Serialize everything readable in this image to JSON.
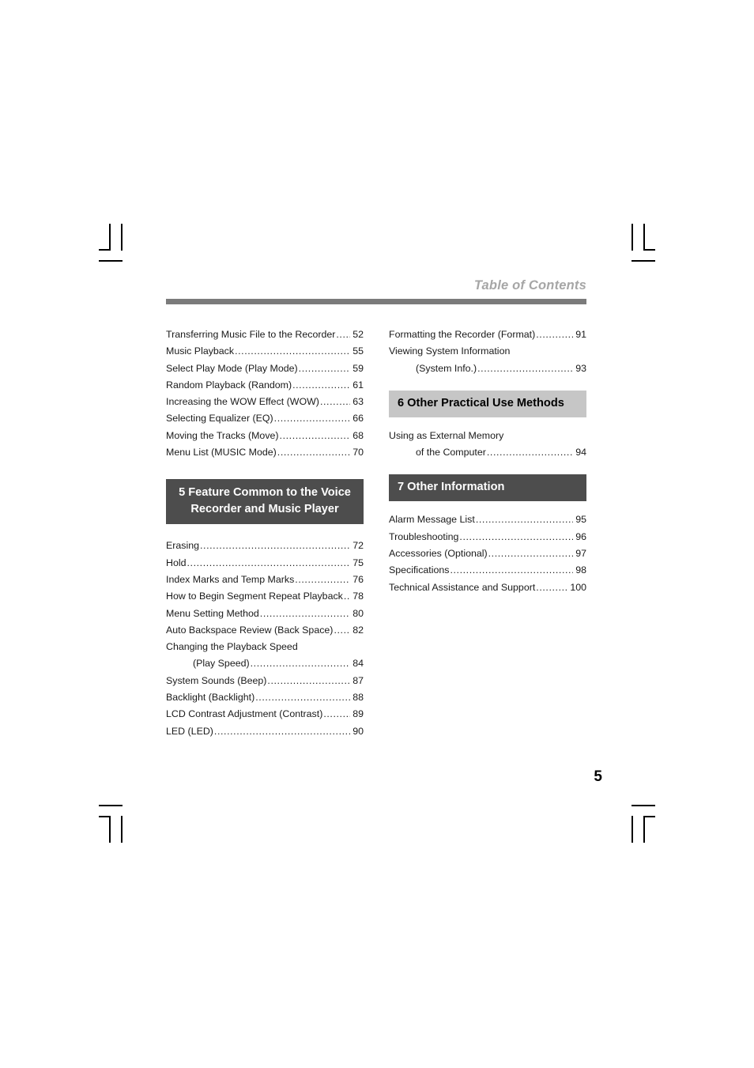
{
  "page": {
    "running_head": "Table of Contents",
    "folio": "5"
  },
  "left_column": {
    "entries_top": [
      {
        "title": "Transferring Music File to the Recorder",
        "page": "52"
      },
      {
        "title": "Music Playback",
        "page": "55"
      },
      {
        "title": "Select Play Mode (Play Mode)",
        "page": "59"
      },
      {
        "title": "Random Playback (Random)",
        "page": "61"
      },
      {
        "title": "Increasing the WOW Effect (WOW)",
        "page": "63"
      },
      {
        "title": "Selecting Equalizer (EQ)",
        "page": "66"
      },
      {
        "title": "Moving the Tracks (Move)",
        "page": "68"
      },
      {
        "title": "Menu List (MUSIC Mode)",
        "page": "70"
      }
    ],
    "section_5": {
      "line1": "5 Feature Common to the Voice",
      "line2": "Recorder and Music Player"
    },
    "entries_bottom": [
      {
        "title": "Erasing",
        "page": "72"
      },
      {
        "title": "Hold",
        "page": "75"
      },
      {
        "title": "Index Marks and Temp Marks",
        "page": "76"
      },
      {
        "title": "How to Begin Segment Repeat Playback",
        "page": "78"
      },
      {
        "title": "Menu Setting Method",
        "page": "80"
      },
      {
        "title": "Auto Backspace Review (Back Space)",
        "page": "82"
      },
      {
        "title": "Changing the Playback Speed",
        "page": "",
        "wrapped": true
      },
      {
        "title": "(Play Speed)",
        "page": "84",
        "indent": true
      },
      {
        "title": "System Sounds (Beep)",
        "page": "87"
      },
      {
        "title": "Backlight (Backlight)",
        "page": "88"
      },
      {
        "title": "LCD Contrast Adjustment (Contrast)",
        "page": "89"
      },
      {
        "title": "LED (LED)",
        "page": "90"
      }
    ]
  },
  "right_column": {
    "entries_top": [
      {
        "title": "Formatting the Recorder (Format)",
        "page": "91"
      },
      {
        "title": "Viewing System Information",
        "page": "",
        "wrapped": true
      },
      {
        "title": "(System Info.)",
        "page": "93",
        "indent": true
      }
    ],
    "section_6": {
      "line1": "6 Other Practical Use Methods"
    },
    "entries_middle": [
      {
        "title": "Using as External Memory",
        "page": "",
        "wrapped": true
      },
      {
        "title": "of the Computer",
        "page": "94",
        "indent": true
      }
    ],
    "section_7": {
      "line1": "7 Other Information"
    },
    "entries_bottom": [
      {
        "title": "Alarm Message List",
        "page": "95"
      },
      {
        "title": "Troubleshooting",
        "page": "96"
      },
      {
        "title": "Accessories (Optional)",
        "page": "97"
      },
      {
        "title": "Specifications",
        "page": "98"
      },
      {
        "title": "Technical Assistance and Support",
        "page": "100"
      }
    ]
  },
  "crop_marks": {
    "color": "#000000",
    "corners": [
      "top-left",
      "top-right",
      "bottom-left",
      "bottom-right"
    ]
  }
}
